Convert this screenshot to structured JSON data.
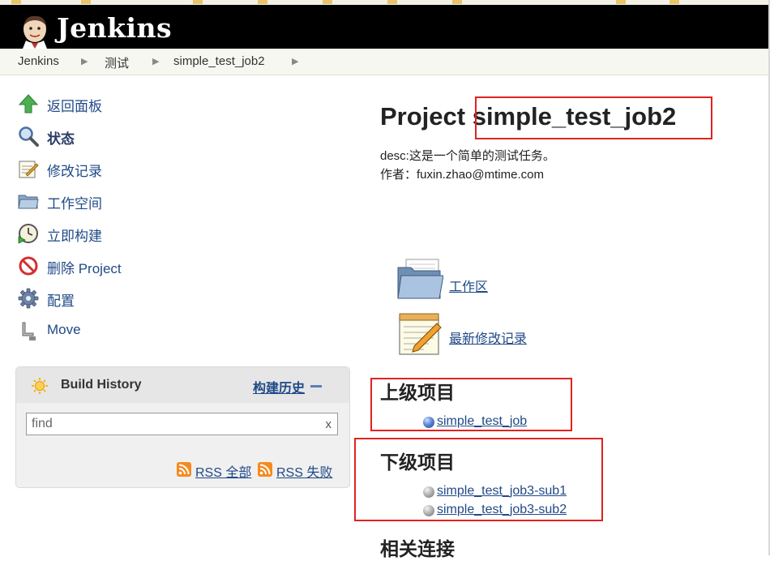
{
  "header": {
    "app_name": "Jenkins"
  },
  "breadcrumb": [
    {
      "label": "Jenkins"
    },
    {
      "label": "测试"
    },
    {
      "label": "simple_test_job2"
    }
  ],
  "sidebar": {
    "tasks": [
      {
        "label": "返回面板",
        "icon": "up-arrow-icon"
      },
      {
        "label": "状态",
        "icon": "magnifier-icon"
      },
      {
        "label": "修改记录",
        "icon": "notepad-icon"
      },
      {
        "label": "工作空间",
        "icon": "folder-icon"
      },
      {
        "label": "立即构建",
        "icon": "clock-play-icon"
      },
      {
        "label": "删除 Project",
        "icon": "no-entry-icon"
      },
      {
        "label": "配置",
        "icon": "gear-icon"
      },
      {
        "label": "Move",
        "icon": "move-icon"
      }
    ]
  },
  "build_history": {
    "title": "Build History",
    "trend_label": "构建历史",
    "search_placeholder": "find",
    "clear_label": "x",
    "rss_all": "RSS 全部",
    "rss_failed": "RSS 失败"
  },
  "main": {
    "title": "Project simple_test_job2",
    "desc": "desc:这是一个简单的测试任务。",
    "author": "作者：fuxin.zhao@mtime.com",
    "workspace_link": "工作区",
    "changes_link": "最新修改记录",
    "upstream_title": "上级项目",
    "upstream": [
      {
        "name": "simple_test_job",
        "status": "blue"
      }
    ],
    "downstream_title": "下级项目",
    "downstream": [
      {
        "name": "simple_test_job3-sub1",
        "status": "grey"
      },
      {
        "name": "simple_test_job3-sub2",
        "status": "grey"
      }
    ],
    "related_title": "相关连接"
  },
  "colors": {
    "header_bg": "#000000",
    "link": "#204a87",
    "annotation_red": "#e0231f",
    "breadcrumb_bg": "#f6f7f0"
  }
}
